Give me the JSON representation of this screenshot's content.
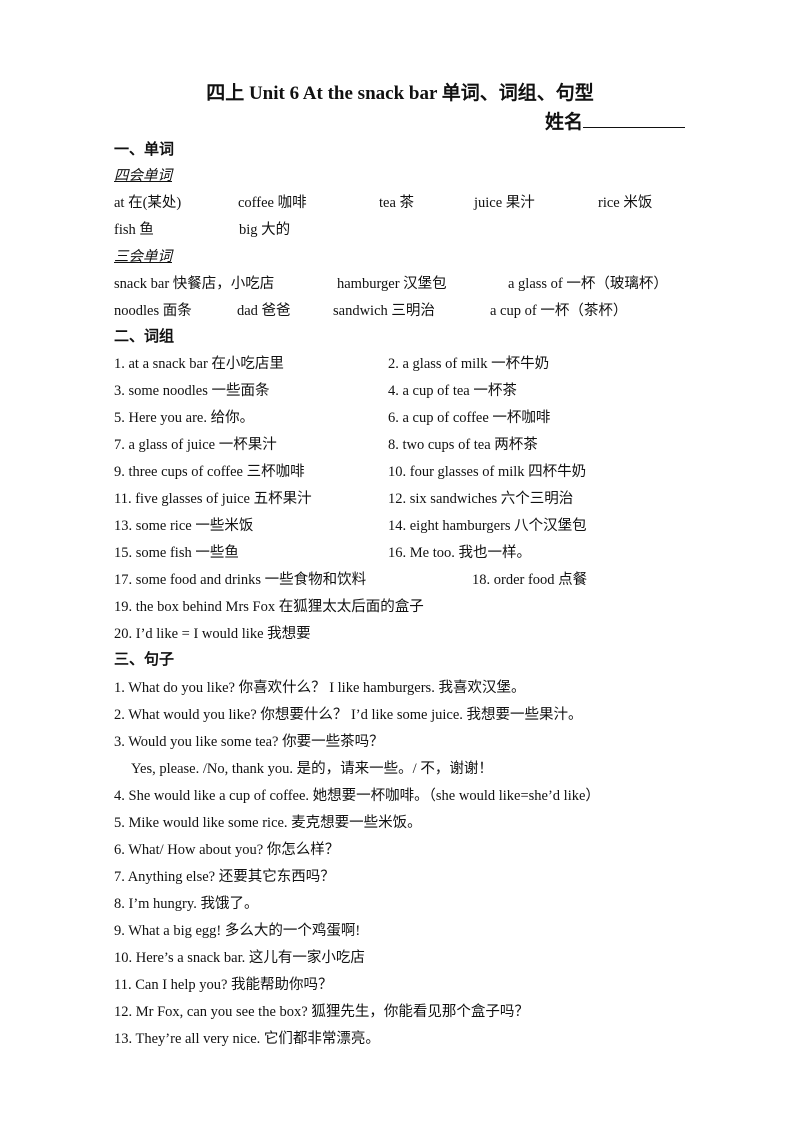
{
  "title": "四上  Unit 6 At the snack bar 单词、词组、句型",
  "name_label": "姓名",
  "sections": {
    "words": {
      "heading": "一、单词",
      "four_skill_label": "四会单词",
      "four_skill": [
        "at 在(某处)",
        "coffee 咖啡",
        "tea 茶",
        "juice 果汁",
        "rice 米饭",
        "fish 鱼",
        "big 大的"
      ],
      "three_skill_label": "三会单词",
      "three_skill": [
        "snack bar  快餐店，小吃店",
        "hamburger  汉堡包",
        "a glass of  一杯（玻璃杯）",
        "noodles  面条",
        "dad  爸爸",
        "sandwich  三明治",
        "a cup of   一杯（茶杯）"
      ]
    },
    "phrases": {
      "heading": "二、词组",
      "items": [
        "1. at a snack bar    在小吃店里",
        "2. a glass of milk    一杯牛奶",
        "3. some noodles    一些面条",
        "4. a cup of tea    一杯茶",
        "5. Here you are.    给你。",
        "6. a cup of coffee    一杯咖啡",
        "7. a glass of juice     一杯果汁",
        "8. two cups of tea    两杯茶",
        "9. three cups of coffee  三杯咖啡",
        "10. four glasses of milk  四杯牛奶",
        "11. five glasses of juice  五杯果汁",
        "12. six sandwiches  六个三明治",
        "13. some rice    一些米饭",
        "14. eight hamburgers    八个汉堡包",
        "15. some fish    一些鱼",
        "16. Me too.  我也一样。",
        "17. some food and drinks    一些食物和饮料",
        "18. order food    点餐",
        "19. the box behind Mrs Fox  在狐狸太太后面的盒子",
        "20. I’d like = I would like  我想要"
      ]
    },
    "sentences": {
      "heading": "三、句子",
      "items": [
        "1. What do you like?  你喜欢什么？   I like hamburgers.  我喜欢汉堡。",
        "2. What would you like?  你想要什么？   I’d like some juice.  我想要一些果汁。",
        "3. Would you like some tea?  你要一些茶吗？",
        "Yes, please. /No, thank you.  是的，请来一些。/  不，谢谢！",
        "4. She would like a cup of coffee.  她想要一杯咖啡。（she would like=she’d like）",
        "5. Mike would like some rice.  麦克想要一些米饭。",
        "6. What/ How about you?    你怎么样？",
        "7. Anything else?  还要其它东西吗？",
        "8. I’m hungry.  我饿了。",
        "9. What a big egg!      多么大的一个鸡蛋啊!",
        "10. Here’s a snack bar.  这儿有一家小吃店",
        "11. Can I help you?  我能帮助你吗？",
        "12. Mr Fox, can you see the box?  狐狸先生，你能看见那个盒子吗？",
        "13. They’re all very nice.  它们都非常漂亮。"
      ]
    }
  }
}
